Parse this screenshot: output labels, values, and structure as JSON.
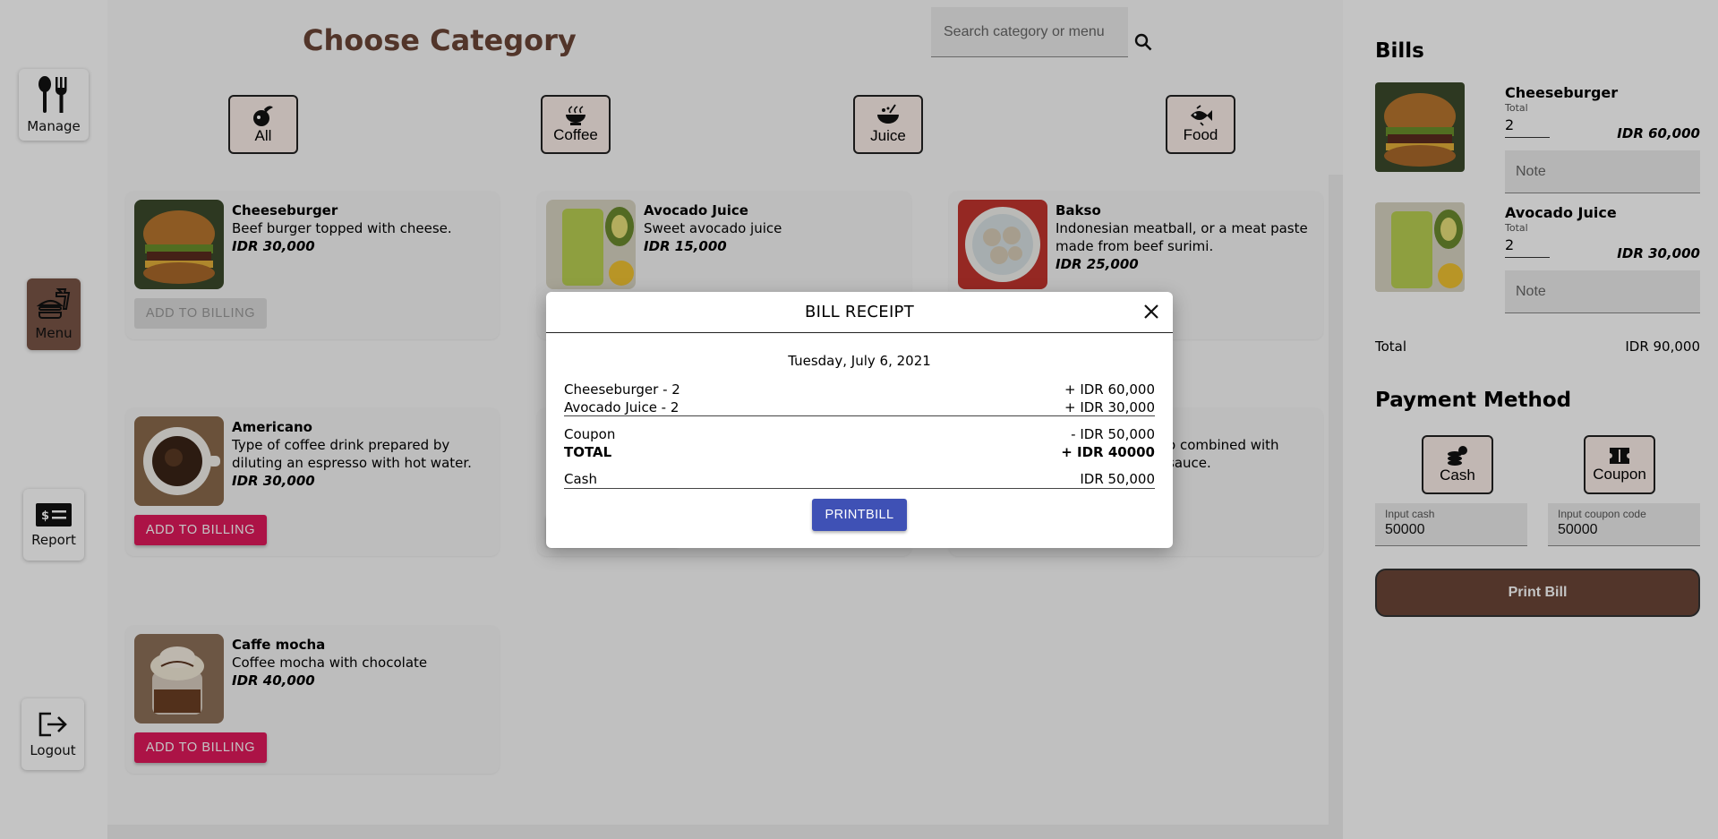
{
  "nav": {
    "items": [
      {
        "label": "Manage",
        "icon": "utensils-icon"
      },
      {
        "label": "Menu",
        "icon": "fastfood-icon"
      },
      {
        "label": "Report",
        "icon": "receipt-money-icon"
      },
      {
        "label": "Logout",
        "icon": "logout-icon"
      }
    ]
  },
  "main": {
    "title": "Choose Category",
    "search": {
      "placeholder": "Search category or menu"
    },
    "categories": [
      {
        "label": "All",
        "icon": "all-food-icon"
      },
      {
        "label": "Coffee",
        "icon": "coffee-bowl-icon"
      },
      {
        "label": "Juice",
        "icon": "juice-icon"
      },
      {
        "label": "Food",
        "icon": "fish-icon"
      }
    ],
    "add_label": "ADD TO BILLING",
    "menu": [
      {
        "name": "Cheeseburger",
        "desc": "Beef burger topped with cheese.",
        "price": "IDR 30,000"
      },
      {
        "name": "Avocado Juice",
        "desc": "Sweet avocado juice",
        "price": "IDR 15,000"
      },
      {
        "name": "Bakso",
        "desc": "Indonesian meatball, or a meat paste made from beef surimi.",
        "price": "IDR 25,000"
      },
      {
        "name": "Americano",
        "desc": "Type of coffee drink prepared by diluting an espresso with hot water.",
        "price": "IDR 30,000"
      },
      {
        "desc_partial": "o combined with",
        "desc_partial2": "sauce."
      },
      {
        "name": "Caffe mocha",
        "desc": "Coffee mocha with chocolate",
        "price": "IDR 40,000"
      }
    ]
  },
  "bills": {
    "title": "Bills",
    "items": [
      {
        "name": "Cheeseburger",
        "total_label": "Total",
        "qty": "2",
        "price": "IDR 60,000",
        "note_placeholder": "Note"
      },
      {
        "name": "Avocado Juice",
        "total_label": "Total",
        "qty": "2",
        "price": "IDR 30,000",
        "note_placeholder": "Note"
      }
    ],
    "total_label": "Total",
    "total_value": "IDR 90,000",
    "payment_title": "Payment Method",
    "methods": [
      {
        "label": "Cash"
      },
      {
        "label": "Coupon"
      }
    ],
    "cash_input": {
      "label": "Input cash",
      "value": "50000"
    },
    "coupon_input": {
      "label": "Input coupon code",
      "value": "50000"
    },
    "print_label": "Print Bill"
  },
  "receipt": {
    "title": "BILL RECEIPT",
    "date": "Tuesday, July 6, 2021",
    "lines": [
      {
        "item": "Cheeseburger - 2",
        "amount": "+ IDR 60,000"
      },
      {
        "item": "Avocado Juice - 2",
        "amount": "+ IDR 30,000"
      }
    ],
    "coupon": {
      "label": "Coupon",
      "amount": "- IDR 50,000"
    },
    "total": {
      "label": "TOTAL",
      "amount": "+ IDR 40000"
    },
    "cash": {
      "label": "Cash",
      "amount": "IDR 50,000"
    },
    "print_label": "PRINTBILL"
  },
  "colors": {
    "brand": "#6b4637",
    "accent": "#e0195b",
    "primary": "#3f51b5"
  }
}
